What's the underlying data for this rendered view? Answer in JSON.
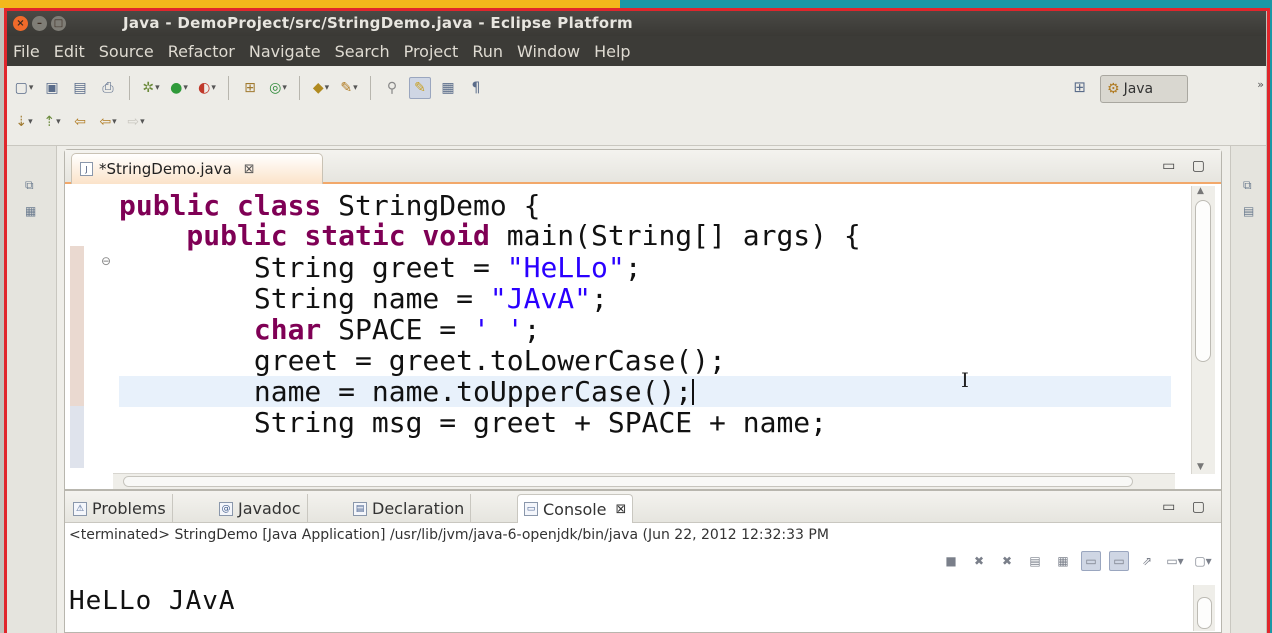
{
  "window": {
    "title": "Java - DemoProject/src/StringDemo.java - Eclipse Platform",
    "buttons": {
      "close": "×",
      "minimize": "–",
      "maximize": "□"
    }
  },
  "menu": [
    "File",
    "Edit",
    "Source",
    "Refactor",
    "Navigate",
    "Search",
    "Project",
    "Run",
    "Window",
    "Help"
  ],
  "toolbar": {
    "perspective_label": "Java",
    "more": "»"
  },
  "editor": {
    "tab_label": "*StringDemo.java",
    "tab_close": "⊠",
    "view_controls": "▭ ▢",
    "code_lines": [
      {
        "parts": [
          {
            "t": "public class ",
            "c": "kw"
          },
          {
            "t": "StringDemo {",
            "c": ""
          }
        ]
      },
      {
        "parts": [
          {
            "t": "    public static void ",
            "c": "kw"
          },
          {
            "t": "main(String[] args) {",
            "c": ""
          }
        ]
      },
      {
        "parts": [
          {
            "t": "        String greet = ",
            "c": ""
          },
          {
            "t": "\"HeLLo\"",
            "c": "str"
          },
          {
            "t": ";",
            "c": ""
          }
        ]
      },
      {
        "parts": [
          {
            "t": "        String name = ",
            "c": ""
          },
          {
            "t": "\"JAvA\"",
            "c": "str"
          },
          {
            "t": ";",
            "c": ""
          }
        ]
      },
      {
        "parts": [
          {
            "t": "        char ",
            "c": "kw"
          },
          {
            "t": "SPACE = ",
            "c": ""
          },
          {
            "t": "' '",
            "c": "str"
          },
          {
            "t": ";",
            "c": ""
          }
        ]
      },
      {
        "parts": [
          {
            "t": "        greet = greet.toLowerCase();",
            "c": ""
          }
        ]
      },
      {
        "parts": [
          {
            "t": "        name = name.toUpperCase();",
            "c": ""
          }
        ]
      },
      {
        "parts": [
          {
            "t": "        String msg = greet + SPACE + name;",
            "c": ""
          }
        ]
      }
    ]
  },
  "bottom_panel": {
    "tabs": [
      {
        "label": "Problems",
        "icon": "⚠",
        "name": "problems"
      },
      {
        "label": "Javadoc",
        "icon": "@",
        "name": "javadoc"
      },
      {
        "label": "Declaration",
        "icon": "▤",
        "name": "declaration"
      },
      {
        "label": "Console",
        "icon": "▭",
        "name": "console",
        "close": "⊠"
      }
    ],
    "status": "<terminated> StringDemo [Java Application] /usr/lib/jvm/java-6-openjdk/bin/java (Jun 22, 2012 12:32:33 PM",
    "output": "HeLLo JAvA"
  }
}
